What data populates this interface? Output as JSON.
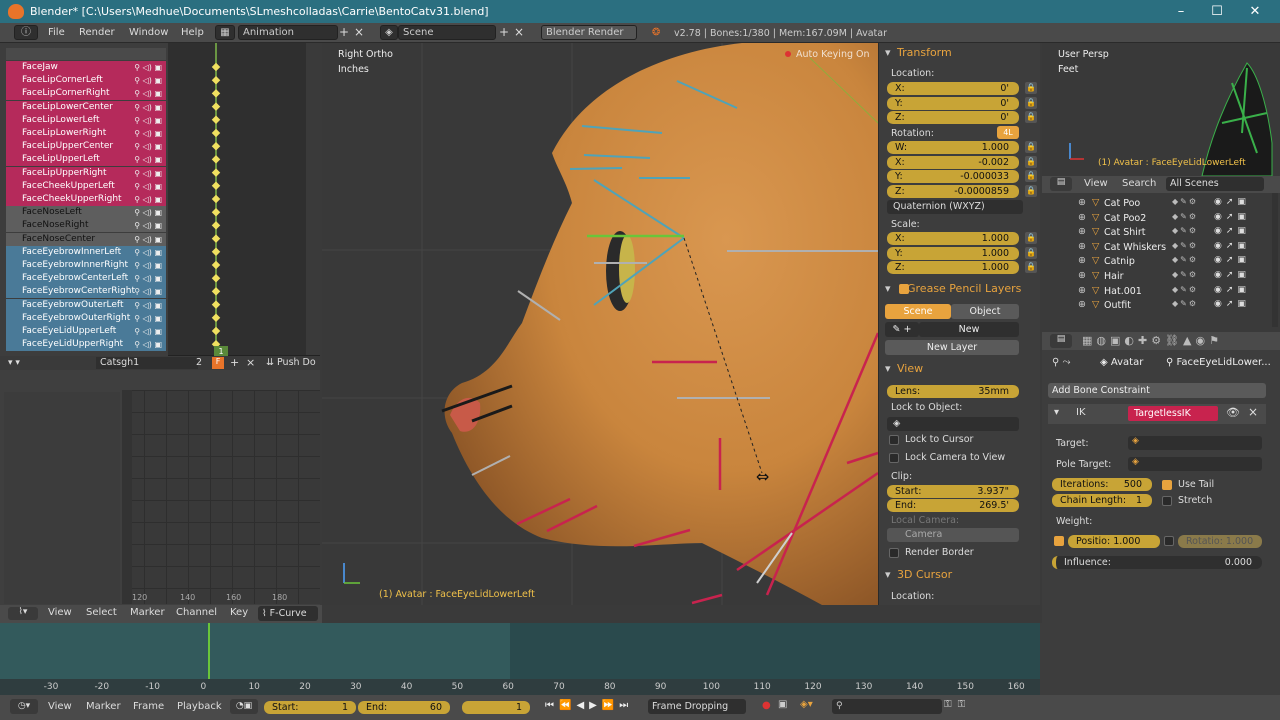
{
  "window": {
    "title": "Blender* [C:\\Users\\Medhue\\Documents\\SLmeshcolladas\\Carrie\\BentoCatv31.blend]",
    "controls": [
      "–",
      "☐",
      "✕"
    ]
  },
  "menubar": {
    "items": [
      "File",
      "Render",
      "Window",
      "Help"
    ],
    "screen_layout": "Animation",
    "scene": "Scene",
    "engine": "Blender Render",
    "stats": "v2.78 | Bones:1/380 | Mem:167.09M | Avatar"
  },
  "dopesheet": {
    "channels": [
      {
        "label": "FaceJaw",
        "style": "red"
      },
      {
        "label": "FaceLipCornerLeft",
        "style": "red"
      },
      {
        "label": "FaceLipCornerRight",
        "style": "red"
      },
      {
        "label": "FaceLipLowerCenter",
        "style": "red"
      },
      {
        "label": "FaceLipLowerLeft",
        "style": "red"
      },
      {
        "label": "FaceLipLowerRight",
        "style": "red"
      },
      {
        "label": "FaceLipUpperCenter",
        "style": "red"
      },
      {
        "label": "FaceLipUpperLeft",
        "style": "red"
      },
      {
        "label": "FaceLipUpperRight",
        "style": "red"
      },
      {
        "label": "FaceCheekUpperLeft",
        "style": "red"
      },
      {
        "label": "FaceCheekUpperRight",
        "style": "red"
      },
      {
        "label": "FaceNoseLeft",
        "style": "gray"
      },
      {
        "label": "FaceNoseRight",
        "style": "gray"
      },
      {
        "label": "FaceNoseCenter",
        "style": "gray"
      },
      {
        "label": "FaceEyebrowInnerLeft",
        "style": "blue"
      },
      {
        "label": "FaceEyebrowInnerRight",
        "style": "blue"
      },
      {
        "label": "FaceEyebrowCenterLeft",
        "style": "blue"
      },
      {
        "label": "FaceEyebrowCenterRight",
        "style": "blue"
      },
      {
        "label": "FaceEyebrowOuterLeft",
        "style": "blue"
      },
      {
        "label": "FaceEyebrowOuterRight",
        "style": "blue"
      },
      {
        "label": "FaceEyeLidUpperLeft",
        "style": "blue"
      },
      {
        "label": "FaceEyeLidUpperRight",
        "style": "blue"
      }
    ],
    "current_frame_badge": "1",
    "ruler": [
      "0",
      "10",
      "20"
    ],
    "action_name": "Catsgh1",
    "action_users": "2",
    "footer_label": "Push Do"
  },
  "graph_editor": {
    "ruler": [
      "120",
      "140",
      "160",
      "180"
    ],
    "tabs": [
      "View",
      "Select",
      "Marker",
      "Channel",
      "Key"
    ],
    "mode": "F-Curve"
  },
  "viewport": {
    "view_name": "Right Ortho",
    "units": "Inches",
    "keying": "Auto Keying On",
    "object_info": "(1) Avatar : FaceEyeLidLowerLeft"
  },
  "npanel": {
    "transform": {
      "title": "Transform",
      "location_label": "Location:",
      "location": [
        {
          "axis": "X:",
          "value": "0'"
        },
        {
          "axis": "Y:",
          "value": "0'"
        },
        {
          "axis": "Z:",
          "value": "0'"
        }
      ],
      "rotation_label": "Rotation:",
      "rotation_badge": "4L",
      "rotation": [
        {
          "axis": "W:",
          "value": "1.000"
        },
        {
          "axis": "X:",
          "value": "-0.002"
        },
        {
          "axis": "Y:",
          "value": "-0.000033"
        },
        {
          "axis": "Z:",
          "value": "-0.0000859"
        }
      ],
      "rotation_mode": "Quaternion (WXYZ)",
      "scale_label": "Scale:",
      "scale": [
        {
          "axis": "X:",
          "value": "1.000"
        },
        {
          "axis": "Y:",
          "value": "1.000"
        },
        {
          "axis": "Z:",
          "value": "1.000"
        }
      ]
    },
    "grease_pencil": {
      "title": "Grease Pencil Layers",
      "tab_scene": "Scene",
      "tab_object": "Object",
      "new_label": "New",
      "new_layer_label": "New Layer"
    },
    "view": {
      "title": "View",
      "lens_label": "Lens:",
      "lens_value": "35mm",
      "lock_to_object_label": "Lock to Object:",
      "lock_to_cursor": "Lock to Cursor",
      "lock_camera": "Lock Camera to View",
      "clip_label": "Clip:",
      "clip_start_label": "Start:",
      "clip_start_value": "3.937\"",
      "clip_end_label": "End:",
      "clip_end_value": "269.5'",
      "local_camera_label": "Local Camera:",
      "camera_value": "Camera",
      "render_border": "Render Border"
    },
    "cursor": {
      "title": "3D Cursor",
      "location_label": "Location:"
    }
  },
  "mini_view": {
    "view_name": "User Persp",
    "units": "Feet",
    "object_info": "(1) Avatar : FaceEyeLidLowerLeft"
  },
  "outliner": {
    "tabs": [
      "View",
      "Search"
    ],
    "filter": "All Scenes",
    "items": [
      "Cat Poo",
      "Cat Poo2",
      "Cat Shirt",
      "Cat Whiskers",
      "Catnip",
      "Hair",
      "Hat.001",
      "Outfit"
    ]
  },
  "bone_constraints": {
    "breadcrumb_object": "Avatar",
    "breadcrumb_bone": "FaceEyeLidLower...",
    "add_label": "Add Bone Constraint",
    "type": "IK",
    "name": "TargetlessIK",
    "target_label": "Target:",
    "pole_target_label": "Pole Target:",
    "iterations_label": "Iterations:",
    "iterations_value": "500",
    "chain_length_label": "Chain Length:",
    "chain_length_value": "1",
    "use_tail": "Use Tail",
    "stretch": "Stretch",
    "weight_label": "Weight:",
    "position_label": "Positio: 1.000",
    "rotation_label": "Rotatio: 1.000",
    "influence_label": "Influence:",
    "influence_value": "0.000"
  },
  "timeline": {
    "ticks": [
      "-30",
      "-20",
      "-10",
      "0",
      "10",
      "20",
      "30",
      "40",
      "50",
      "60",
      "70",
      "80",
      "90",
      "100",
      "110",
      "120",
      "130",
      "140",
      "150",
      "160"
    ],
    "menu": [
      "View",
      "Marker",
      "Frame",
      "Playback"
    ],
    "start_label": "Start:",
    "start_value": "1",
    "end_label": "End:",
    "end_value": "60",
    "current_value": "1",
    "sync_mode": "Frame Dropping"
  }
}
